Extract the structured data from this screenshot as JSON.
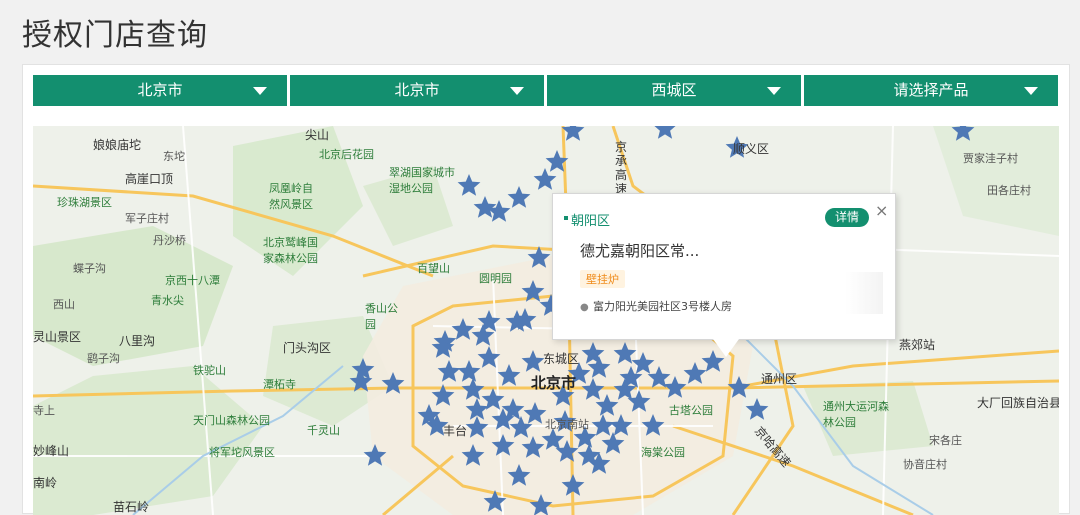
{
  "page": {
    "title": "授权门店查询"
  },
  "filters": [
    {
      "value": "北京市"
    },
    {
      "value": "北京市"
    },
    {
      "value": "西城区"
    },
    {
      "value": "请选择产品"
    }
  ],
  "map": {
    "labels": {
      "l1": "娘娘庙坨",
      "l2": "东坨",
      "l3": "高崖口顶",
      "l4": "珍珠湖景区",
      "l5": "军子庄村",
      "l6": "尖山",
      "l7": "北京后花园",
      "l8": "翠湖国家城市湿地公园",
      "l9": "凤凰岭自然风景区",
      "l10": "北京鹫峰国家森林公园",
      "l11": "百望山",
      "l12": "圆明园",
      "l13": "香山公园",
      "l14": "灵山景区",
      "l15": "京西十八潭",
      "l16": "青水尖",
      "l17": "八里沟",
      "l18": "门头沟区",
      "l19": "铁驼山",
      "l20": "潭柘寺",
      "l21": "天门山森林公园",
      "l22": "千灵山",
      "l23": "将军坨风景区",
      "l24": "妙峰山",
      "l25": "东城区",
      "l26": "北京市",
      "l27": "北京南站",
      "l28": "古塔公园",
      "l29": "海棠公园",
      "l30": "通州区",
      "l31": "通州大运河森林公园",
      "l32": "贾家洼子村",
      "l33": "田各庄村",
      "l34": "燕郊站",
      "l35": "大厂回族自治县",
      "l36": "宋各庄",
      "l37": "协音庄村",
      "l38": "南岭",
      "l39": "苗石岭",
      "l40": "京承高速",
      "l41": "丰台",
      "l42": "蝶子沟",
      "l43": "鹞子沟",
      "l44": "寺上",
      "l45": "丹沙桥",
      "l46": "西山",
      "l47": "顺义区",
      "l48": "京哈高速"
    },
    "stores_shown": 74
  },
  "popup": {
    "district": "朝阳区",
    "detail_label": "详情",
    "close": "×",
    "store_name": "德尤嘉朝阳区常...",
    "tag": "壁挂炉",
    "address": "富力阳光美园社区3号楼人房"
  },
  "colors": {
    "accent": "#138f6f",
    "marker": "#4f79b5",
    "tag": "#ef8b1b"
  }
}
